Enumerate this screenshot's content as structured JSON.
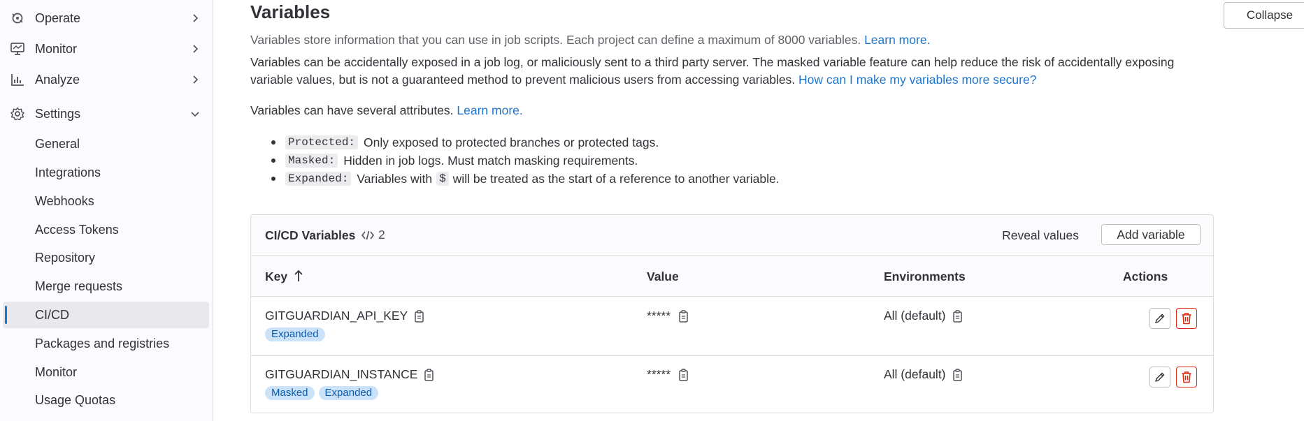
{
  "sidebar": {
    "sections": [
      {
        "label": "Operate",
        "icon": "deployments-icon"
      },
      {
        "label": "Monitor",
        "icon": "monitor-icon"
      },
      {
        "label": "Analyze",
        "icon": "chart-icon"
      },
      {
        "label": "Settings",
        "icon": "gear-icon"
      }
    ],
    "settings_items": [
      {
        "label": "General"
      },
      {
        "label": "Integrations"
      },
      {
        "label": "Webhooks"
      },
      {
        "label": "Access Tokens"
      },
      {
        "label": "Repository"
      },
      {
        "label": "Merge requests"
      },
      {
        "label": "CI/CD"
      },
      {
        "label": "Packages and registries"
      },
      {
        "label": "Monitor"
      },
      {
        "label": "Usage Quotas"
      }
    ]
  },
  "main": {
    "title": "Variables",
    "collapse_label": "Collapse",
    "intro": "Variables store information that you can use in job scripts. Each project can define a maximum of 8000 variables.",
    "intro_link": "Learn more.",
    "warning": "Variables can be accidentally exposed in a job log, or maliciously sent to a third party server. The masked variable feature can help reduce the risk of accidentally exposing variable values, but is not a guaranteed method to prevent malicious users from accessing variables.",
    "warning_link": "How can I make my variables more secure?",
    "attributes_intro": "Variables can have several attributes.",
    "attributes_link": "Learn more.",
    "attributes": [
      {
        "tag": "Protected:",
        "text": "Only exposed to protected branches or protected tags."
      },
      {
        "tag": "Masked:",
        "text": "Hidden in job logs. Must match masking requirements."
      },
      {
        "tag": "Expanded:",
        "text_before": "Variables with",
        "code": "$",
        "text_after": "will be treated as the start of a reference to another variable."
      }
    ]
  },
  "card": {
    "title": "CI/CD Variables",
    "count": "2",
    "reveal_label": "Reveal values",
    "add_label": "Add variable",
    "columns": {
      "key": "Key",
      "value": "Value",
      "environments": "Environments",
      "actions": "Actions"
    },
    "rows": [
      {
        "key": "GITGUARDIAN_API_KEY",
        "value": "*****",
        "environment": "All (default)",
        "badges": [
          "Expanded"
        ]
      },
      {
        "key": "GITGUARDIAN_INSTANCE",
        "value": "*****",
        "environment": "All (default)",
        "badges": [
          "Masked",
          "Expanded"
        ]
      }
    ]
  },
  "colors": {
    "link": "#1f75cb",
    "badge_bg": "#cbe2f9",
    "badge_text": "#0b5cad",
    "danger": "#dd2b0e",
    "active_indicator": "#1f75cb"
  }
}
